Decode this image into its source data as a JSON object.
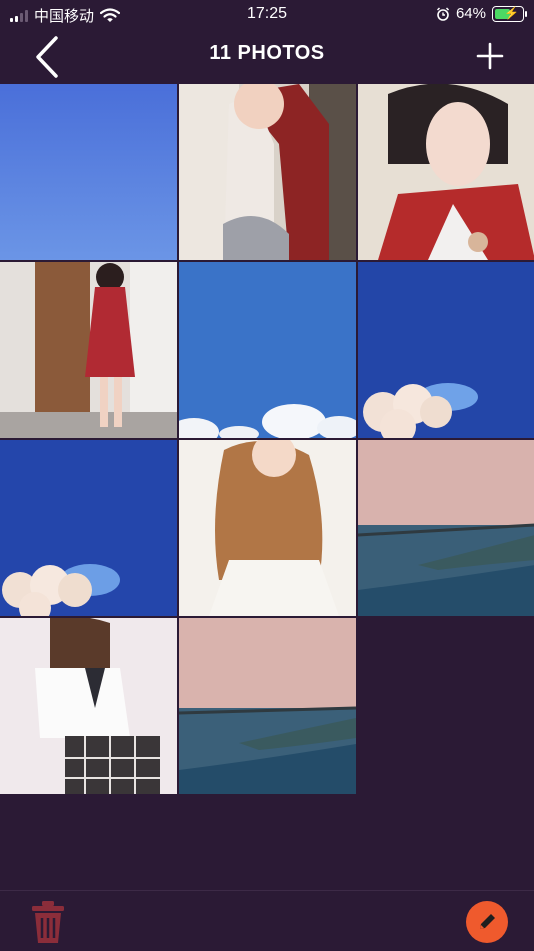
{
  "status_bar": {
    "carrier": "中国移动",
    "time": "17:25",
    "battery_percent": "64%",
    "battery_level": 0.64,
    "icons": [
      "signal-icon",
      "wifi-icon",
      "alarm-icon",
      "battery-charging-icon"
    ]
  },
  "nav": {
    "title": "11 PHOTOS",
    "back_icon": "chevron-left-icon",
    "add_icon": "plus-icon"
  },
  "photos": [
    {
      "name": "photo-blue-sky",
      "subject": "blue sky"
    },
    {
      "name": "photo-girl-red-jacket",
      "subject": "girl in red jacket"
    },
    {
      "name": "photo-girl-hanfu",
      "subject": "girl in red hanfu"
    },
    {
      "name": "photo-girl-red-dress-door",
      "subject": "girl in red dress by door"
    },
    {
      "name": "photo-sky-clouds",
      "subject": "sky with clouds"
    },
    {
      "name": "photo-blossom-sky-1",
      "subject": "blossoms against sky"
    },
    {
      "name": "photo-blossom-sky-2",
      "subject": "blossoms against sky"
    },
    {
      "name": "photo-girl-curly-hair",
      "subject": "girl with long curly hair"
    },
    {
      "name": "photo-sea-coast-1",
      "subject": "sea coastline at dusk"
    },
    {
      "name": "photo-girl-school-uniform",
      "subject": "girl in school uniform"
    },
    {
      "name": "photo-sea-coast-2",
      "subject": "sea coastline at dusk"
    }
  ],
  "bottom_bar": {
    "trash_icon": "trash-icon",
    "edit_icon": "pencil-icon"
  },
  "colors": {
    "background": "#2b1a35",
    "trash": "#8b2d3a",
    "edit_button": "#ef5a2d"
  }
}
